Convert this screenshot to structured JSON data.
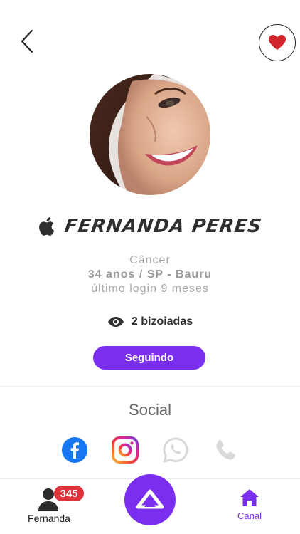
{
  "profile": {
    "name": "FERNANDA PERES",
    "sign": "Câncer",
    "age_location": "34 anos / SP - Bauru",
    "last_login": "último login 9 meses",
    "views": "2 bizoiadas",
    "follow_label": "Seguindo",
    "platform_icon": "apple-icon"
  },
  "social": {
    "title": "Social",
    "items": [
      {
        "name": "facebook-icon",
        "color": "#1877f2",
        "active": true
      },
      {
        "name": "instagram-icon",
        "color": "#d6249f",
        "active": true
      },
      {
        "name": "whatsapp-icon",
        "color": "#d9d9d9",
        "active": false
      },
      {
        "name": "phone-icon",
        "color": "#d9d9d9",
        "active": false
      }
    ]
  },
  "bottom_nav": {
    "user_label": "Fernanda",
    "badge_count": "345",
    "canal_label": "Canal"
  },
  "colors": {
    "accent": "#7a2ff0",
    "heart": "#d0252d",
    "badge": "#e0323b"
  }
}
